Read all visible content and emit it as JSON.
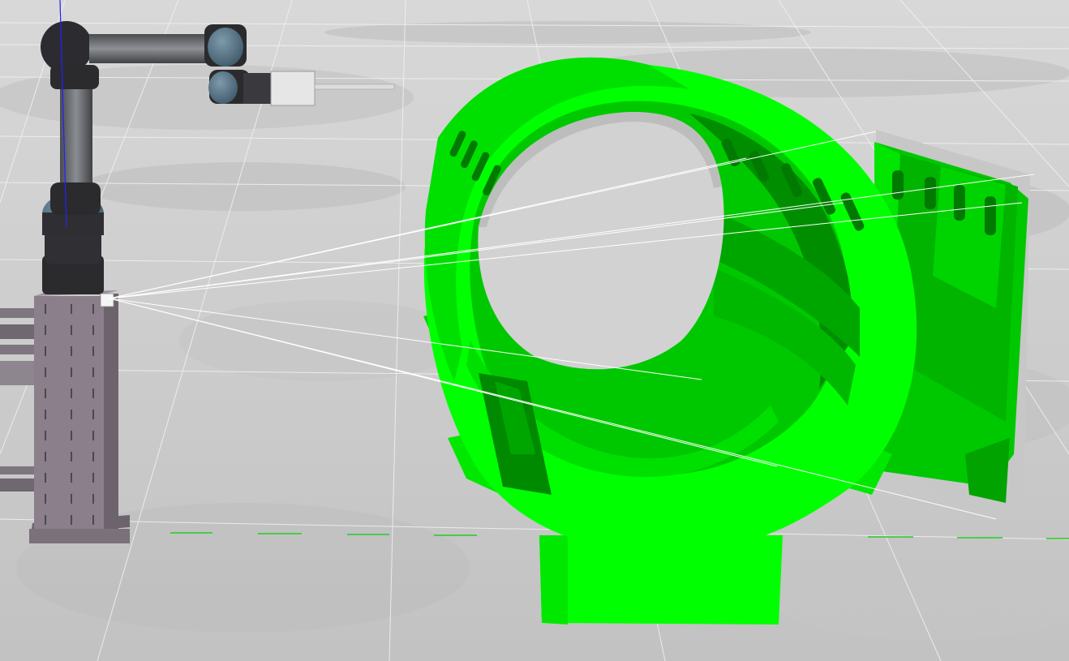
{
  "viewport": {
    "background": "#cfcfcf",
    "floor_color": "#d4d4d4",
    "grid_color": "#f2f2f2"
  },
  "colors": {
    "part_bright": "#00ff00",
    "part_mid": "#00d200",
    "part_dark": "#00a300",
    "part_darker": "#007a00",
    "pedestal": "#8a7f8a",
    "pedestal_dark": "#6c636d",
    "robot_black": "#2b2b2e",
    "robot_gray": "#6b6e72",
    "joint_cap": "#4e6c7e",
    "sensor_white": "#e6e6e6",
    "ray_color": "#ffffff",
    "axis_z": "#2222ff",
    "tick_green": "#22cc22"
  },
  "scene_objects": {
    "robot_arm": "ur-robot-arm",
    "pedestal": "robot-pedestal",
    "workpiece": "green-workpiece",
    "plate": "green-plate",
    "camera": "camera-sensor"
  }
}
